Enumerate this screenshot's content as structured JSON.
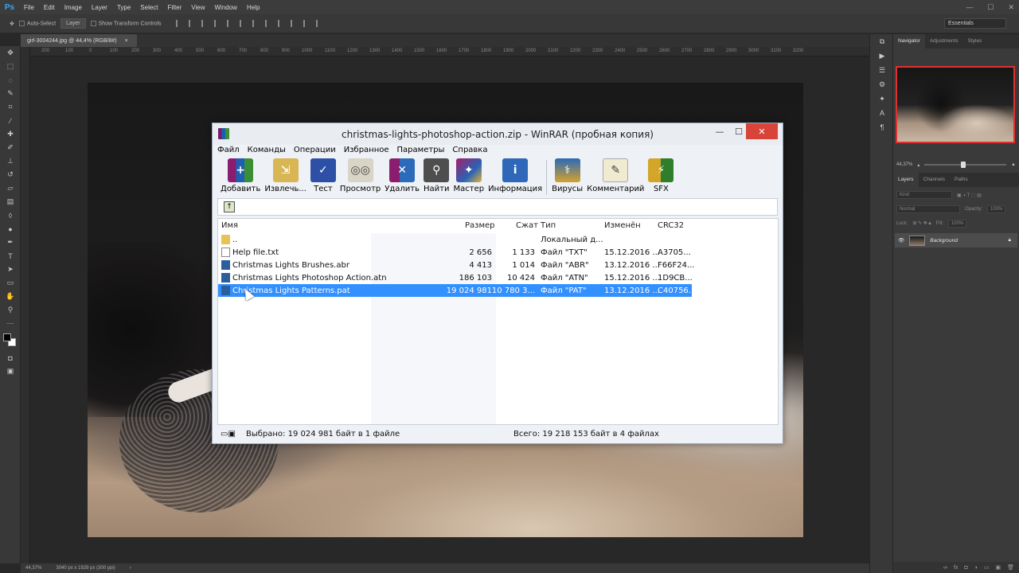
{
  "photoshop": {
    "logo": "Ps",
    "menu": [
      "File",
      "Edit",
      "Image",
      "Layer",
      "Type",
      "Select",
      "Filter",
      "View",
      "Window",
      "Help"
    ],
    "window_controls": [
      "—",
      "☐",
      "✕"
    ],
    "options": {
      "auto_select": "Auto-Select",
      "auto_select_target": "Layer",
      "show_transform": "Show Transform Controls",
      "workspace": "Essentials"
    },
    "doc_tab": {
      "title": "girl-3004244.jpg @ 44,4% (RGB/8#)",
      "close": "×"
    },
    "ruler_marks": [
      "200",
      "100",
      "0",
      "100",
      "200",
      "300",
      "400",
      "500",
      "600",
      "700",
      "800",
      "900",
      "1000",
      "1100",
      "1200",
      "1300",
      "1400",
      "1500",
      "1600",
      "1700",
      "1800",
      "1900",
      "2000",
      "2100",
      "2200",
      "2300",
      "2400",
      "2500",
      "2600",
      "2700",
      "2800",
      "2900",
      "3000",
      "3100",
      "3200"
    ],
    "status": {
      "zoom": "44,37%",
      "doc_info": "3040 px x 1929 px (300 ppi)"
    },
    "panels": {
      "top_tabs": [
        "Navigator",
        "Adjustments",
        "Styles"
      ],
      "navigator_zoom": "44,37%",
      "layers_tabs": [
        "Layers",
        "Channels",
        "Paths"
      ],
      "kind_label": "Kind",
      "blend_mode": "Normal",
      "opacity_label": "Opacity:",
      "opacity_value": "100%",
      "lock_label": "Lock:",
      "fill_label": "Fill:",
      "fill_value": "100%",
      "layer_name": "Background"
    }
  },
  "winrar": {
    "title": "christmas-lights-photoshop-action.zip - WinRAR (пробная копия)",
    "menu": [
      "Файл",
      "Команды",
      "Операции",
      "Избранное",
      "Параметры",
      "Справка"
    ],
    "toolbar": [
      "Добавить",
      "Извлечь...",
      "Тест",
      "Просмотр",
      "Удалить",
      "Найти",
      "Мастер",
      "Информация",
      "Вирусы",
      "Комментарий",
      "SFX"
    ],
    "columns": [
      "Имя",
      "Размер",
      "Сжат",
      "Тип",
      "Изменён",
      "CRC32"
    ],
    "rows": [
      {
        "name": "..",
        "size": "",
        "packed": "",
        "type": "Локальный д...",
        "modified": "",
        "crc": ""
      },
      {
        "name": "Help file.txt",
        "size": "2 656",
        "packed": "1 133",
        "type": "Файл \"TXT\"",
        "modified": "15.12.2016 ...",
        "crc": "A3705..."
      },
      {
        "name": "Christmas Lights Brushes.abr",
        "size": "4 413",
        "packed": "1 014",
        "type": "Файл \"ABR\"",
        "modified": "13.12.2016 ...",
        "crc": "F66F24..."
      },
      {
        "name": "Christmas Lights Photoshop Action.atn",
        "size": "186 103",
        "packed": "10 424",
        "type": "Файл \"ATN\"",
        "modified": "15.12.2016 ...",
        "crc": "1D9CB..."
      },
      {
        "name": "Christmas Lights Patterns.pat",
        "size": "19 024 981",
        "packed": "10 780 3...",
        "type": "Файл \"PAT\"",
        "modified": "13.12.2016 ...",
        "crc": "C40756..."
      }
    ],
    "status_left": "Выбрано: 19 024 981 байт в 1 файле",
    "status_right": "Всего: 19 218 153 байт в 4 файлах"
  }
}
